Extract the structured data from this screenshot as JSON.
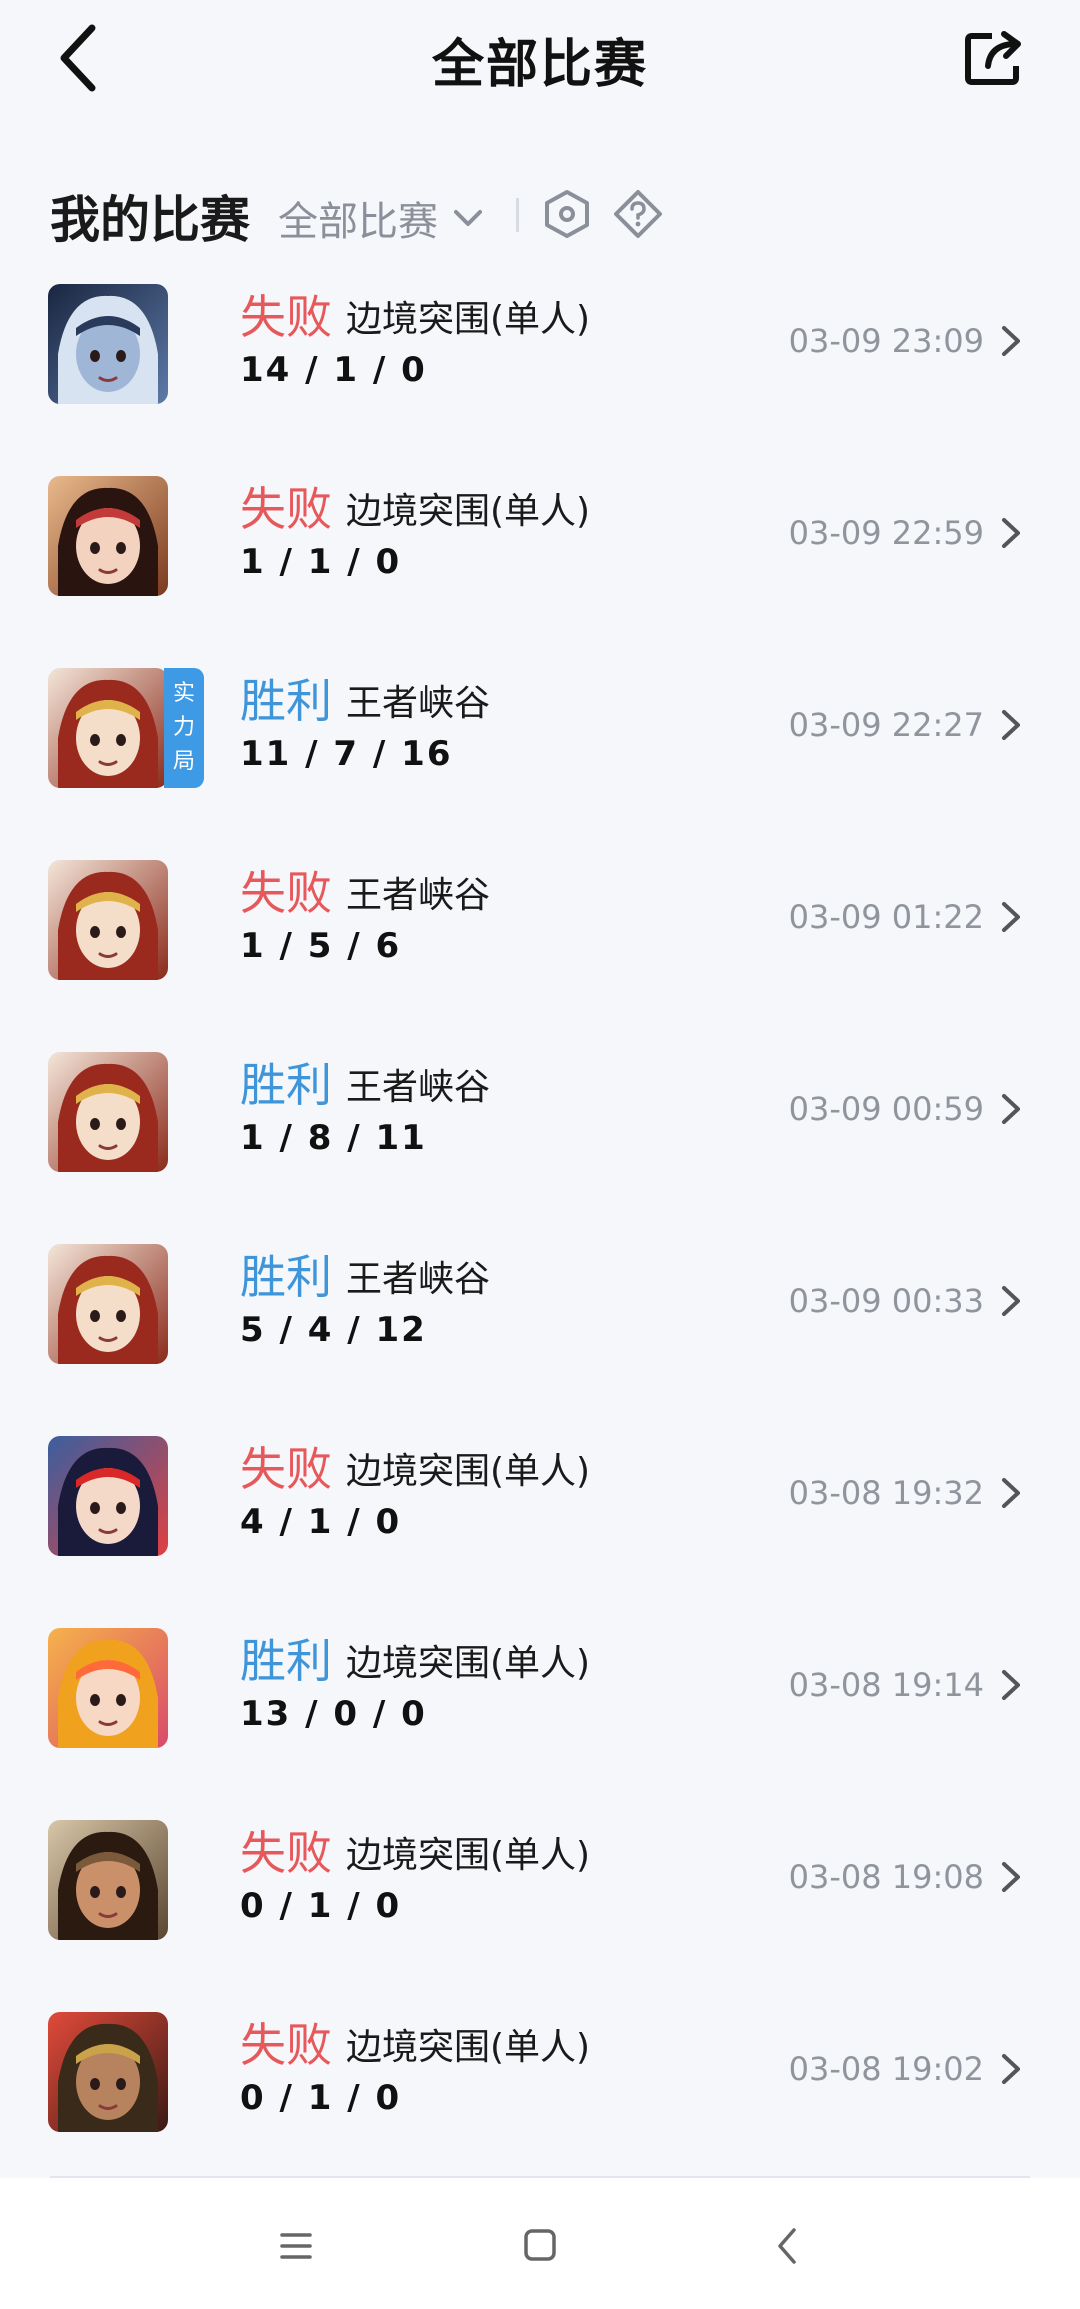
{
  "header": {
    "title": "全部比赛",
    "back_icon": "back-chevron-icon",
    "share_icon": "share-icon"
  },
  "filter": {
    "section_title": "我的比赛",
    "dropdown_label": "全部比赛",
    "icons": [
      "chevron-down-icon",
      "hexagon-icon",
      "diamond-question-icon"
    ]
  },
  "colors": {
    "lose": "#e7585b",
    "win": "#3e95d9",
    "time": "#8f949d",
    "badge": "#3f9ae6"
  },
  "matches": [
    {
      "result": "失败",
      "mode": "边境突围(单人)",
      "kda": "14 / 1 / 0",
      "time": "03-09 23:09",
      "badge": null,
      "hero": "hero-avatar-masked"
    },
    {
      "result": "失败",
      "mode": "边境突围(单人)",
      "kda": "1 / 1 / 0",
      "time": "03-09 22:59",
      "badge": null,
      "hero": "hero-avatar-female-dark-hair"
    },
    {
      "result": "胜利",
      "mode": "王者峡谷",
      "kda": "11 / 7 / 16",
      "time": "03-09 22:27",
      "badge": "实力局",
      "hero": "hero-avatar-red-hood"
    },
    {
      "result": "失败",
      "mode": "王者峡谷",
      "kda": "1 / 5 / 6",
      "time": "03-09 01:22",
      "badge": null,
      "hero": "hero-avatar-red-hood"
    },
    {
      "result": "胜利",
      "mode": "王者峡谷",
      "kda": "1 / 8 / 11",
      "time": "03-09 00:59",
      "badge": null,
      "hero": "hero-avatar-red-hood"
    },
    {
      "result": "胜利",
      "mode": "王者峡谷",
      "kda": "5 / 4 / 12",
      "time": "03-09 00:33",
      "badge": null,
      "hero": "hero-avatar-red-hood"
    },
    {
      "result": "失败",
      "mode": "边境突围(单人)",
      "kda": "4 / 1 / 0",
      "time": "03-08 19:32",
      "badge": null,
      "hero": "hero-avatar-female-red-scarf"
    },
    {
      "result": "胜利",
      "mode": "边境突围(单人)",
      "kda": "13 / 0 / 0",
      "time": "03-08 19:14",
      "badge": null,
      "hero": "hero-avatar-golden-hair"
    },
    {
      "result": "失败",
      "mode": "边境突围(单人)",
      "kda": "0 / 1 / 0",
      "time": "03-08 19:08",
      "badge": null,
      "hero": "hero-avatar-bearded-warrior"
    },
    {
      "result": "失败",
      "mode": "边境突围(单人)",
      "kda": "0 / 1 / 0",
      "time": "03-08 19:02",
      "badge": null,
      "hero": "hero-avatar-helmet-warrior"
    }
  ],
  "system_nav": {
    "icons": [
      "menu-icon",
      "home-icon",
      "back-icon"
    ]
  }
}
